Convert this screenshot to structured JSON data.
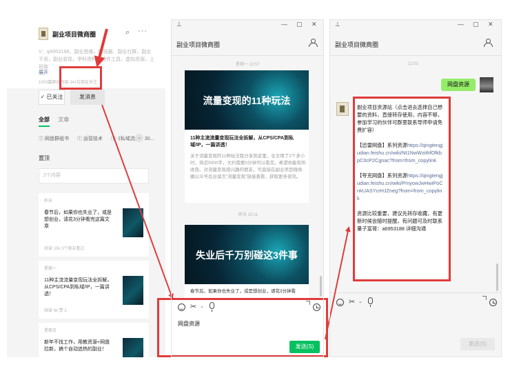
{
  "account": {
    "name": "副业项目微商圈",
    "description": "V：qi6953188，副业思维，赚钱圈、副业社群，副业干货，副业变现，学科资料，软件工具，虚拟资源，上班族",
    "expand_label": "展开",
    "stats": "1003篇原创内容  341位朋友关注",
    "followed_label": "✓ 已关注",
    "message_label": "发消息"
  },
  "profile_tabs": [
    "全部",
    "文章"
  ],
  "profile_menu": [
    "ⓘ 网盘群组书",
    "ⓘ 运营技术",
    "ⓘ《私域流量》30..."
  ],
  "profile_section": "置顶",
  "profile_filter": "2个内容",
  "profile_articles": [
    {
      "when": "昨天",
      "title": "春节后，如果你也失业了，或是想创业，请花3分钟看完这篇文章",
      "meta": "阅读 10k  3个朋友看过"
    },
    {
      "when": "星期一",
      "title": "11种主流流量变现玩法全拆解，从CPS/CPA到私域/IP，一篇讲透！",
      "meta": "阅读 6k  赞 2"
    },
    {
      "when": "星期日",
      "title": "新年不找工作，用教资源+网盘拉新，搞个自动追热的副业！",
      "meta": ""
    }
  ],
  "chat": {
    "title": "副业项目微商圈",
    "time1": "星期一 22:57",
    "article1_cover": "流量变现的11种玩法",
    "article1_title": "11种主流流量变现玩法全拆解，从CPS/CPA到私域/IP，一篇讲透！",
    "article1_excerpt": "关于流量变现的11种玩法我分享到这里，全文用了2个多小时，将近5000字，大约需要5分钟可以看完，希望你能有所收获。对流量变现感兴趣的朋友，可直接在副业项目微商圈公众号后台留言“流量变现”链接查看，获取更多资讯。",
    "time2": "昨天 10:11",
    "article2_cover": "失业后千万别碰这3件事",
    "article2_snippet": "春节后，如果你也失业了，或是想创业，请花3分钟看",
    "typed_text": "网盘资源",
    "send_label": "发送(S)"
  },
  "reply_chat": {
    "title": "副业项目微商圈",
    "time": "12:01",
    "outgoing": "网盘资源",
    "reply_intro": "副业项目资源站（点击进去选择自己想要的资料，直接转存使用，内容不够，参加学习的伙伴可群里联系导师申请免费扩容）",
    "xunlei_label": "【迅雷网盘】系列资源",
    "xunlei_link": "https://qingtengjudian.feishu.cn/wiki/Nt1NwWzithfOfkbpC0cP2Cgnac?from=from_copylink",
    "kuake_label": "【夸克网盘】系列资源",
    "kuake_link": "https://qingtengjudian.feishu.cn/wiki/PmyowJwHwiPoCnkUASYcrHJZneg?from=from_copylink",
    "reply_footer": "资源比较重要，建议先转存收藏，有更新时候会随时提醒，有问题可及时联系量子富哥：a6953188 详细沟通",
    "send_label": "发送(S)"
  },
  "icons": [
    "search-icon",
    "more-icon",
    "pin-icon",
    "minimize-icon",
    "maximize-icon",
    "close-icon",
    "user-icon",
    "emoji-icon",
    "scissors-icon",
    "mic-icon",
    "history-icon"
  ],
  "colors": {
    "accent_green": "#07c160",
    "bubble_green": "#95ec69",
    "highlight_red": "#e03b3b",
    "link_blue": "#576b95"
  }
}
